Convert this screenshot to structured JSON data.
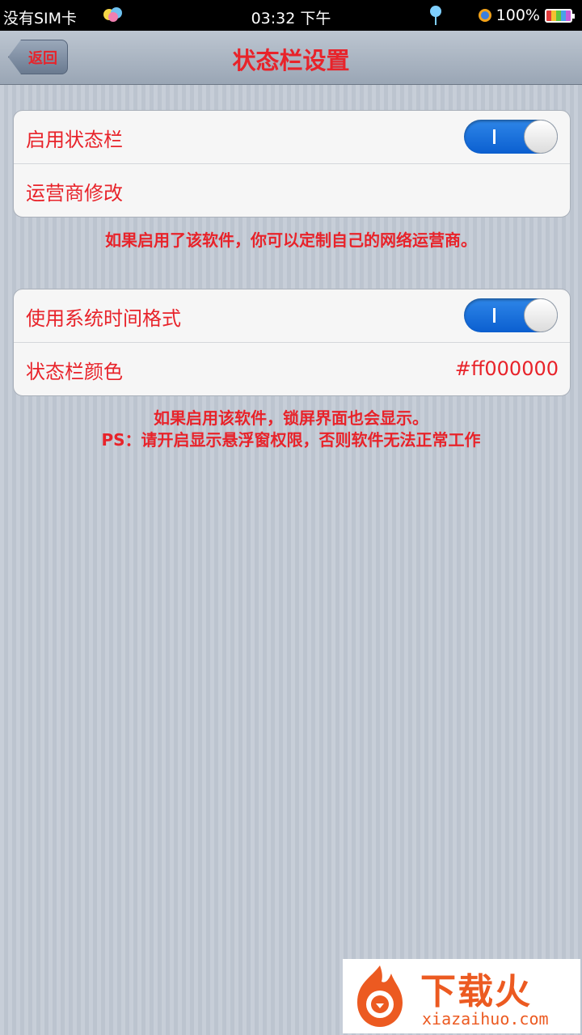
{
  "status_bar": {
    "carrier": "没有SIM卡",
    "time": "03:32 下午",
    "battery": "100%"
  },
  "nav": {
    "back_label": "返回",
    "title": "状态栏设置"
  },
  "group1": {
    "rows": [
      {
        "label": "启用状态栏",
        "toggle": true
      },
      {
        "label": "运营商修改"
      }
    ],
    "note": "如果启用了该软件，你可以定制自己的网络运营商。"
  },
  "group2": {
    "rows": [
      {
        "label": "使用系统时间格式",
        "toggle": true
      },
      {
        "label": "状态栏颜色",
        "value": "#ff000000"
      }
    ],
    "note_line1": "如果启用该软件，锁屏界面也会显示。",
    "note_line2": "PS：请开启显示悬浮窗权限，否则软件无法正常工作"
  },
  "watermark": {
    "title": "下载火",
    "url": "xiazaihuo.com"
  },
  "colors": {
    "accent_text": "#e8232a",
    "toggle_on": "#0b5fd0"
  }
}
